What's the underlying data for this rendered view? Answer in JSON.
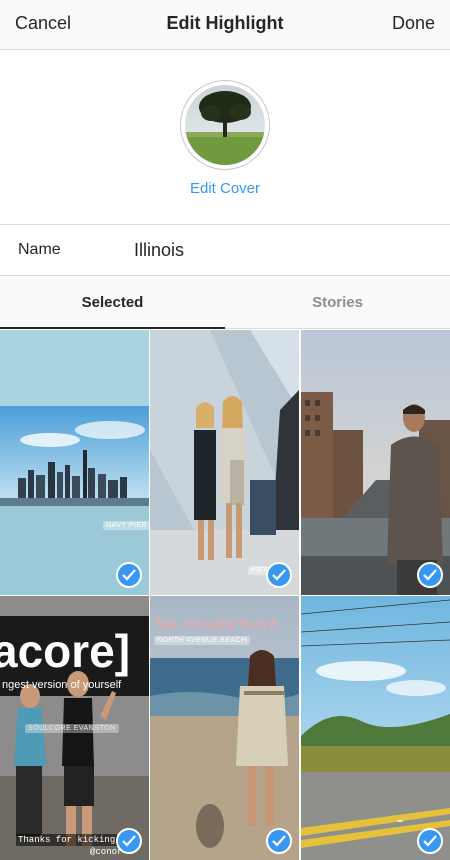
{
  "header": {
    "cancel_label": "Cancel",
    "title": "Edit Highlight",
    "done_label": "Done"
  },
  "cover": {
    "edit_label": "Edit Cover"
  },
  "name_field": {
    "label": "Name",
    "value": "Illinois"
  },
  "tabs": [
    {
      "label": "Selected",
      "active": true
    },
    {
      "label": "Stories",
      "active": false
    }
  ],
  "grid": [
    {
      "sticker": "NAVY PIER",
      "selected": true
    },
    {
      "sticker": "PIER",
      "selected": true
    },
    {
      "sticker": "",
      "selected": true
    },
    {
      "banner": "acore]",
      "subtext": "ngest version of yourself",
      "sticker": "SOULCORE EVANSTON",
      "caption": "Thanks for kicking",
      "handle": "@conor",
      "selected": true
    },
    {
      "sticker": "NORTH AVENUE BEACH",
      "selected": true
    },
    {
      "sticker": "",
      "selected": true
    }
  ],
  "colors": {
    "accent": "#3897f0",
    "text": "#262626",
    "muted": "#8e8e8e",
    "divider": "#dbdbdb"
  },
  "icons": {
    "check": "checkmark-icon"
  }
}
